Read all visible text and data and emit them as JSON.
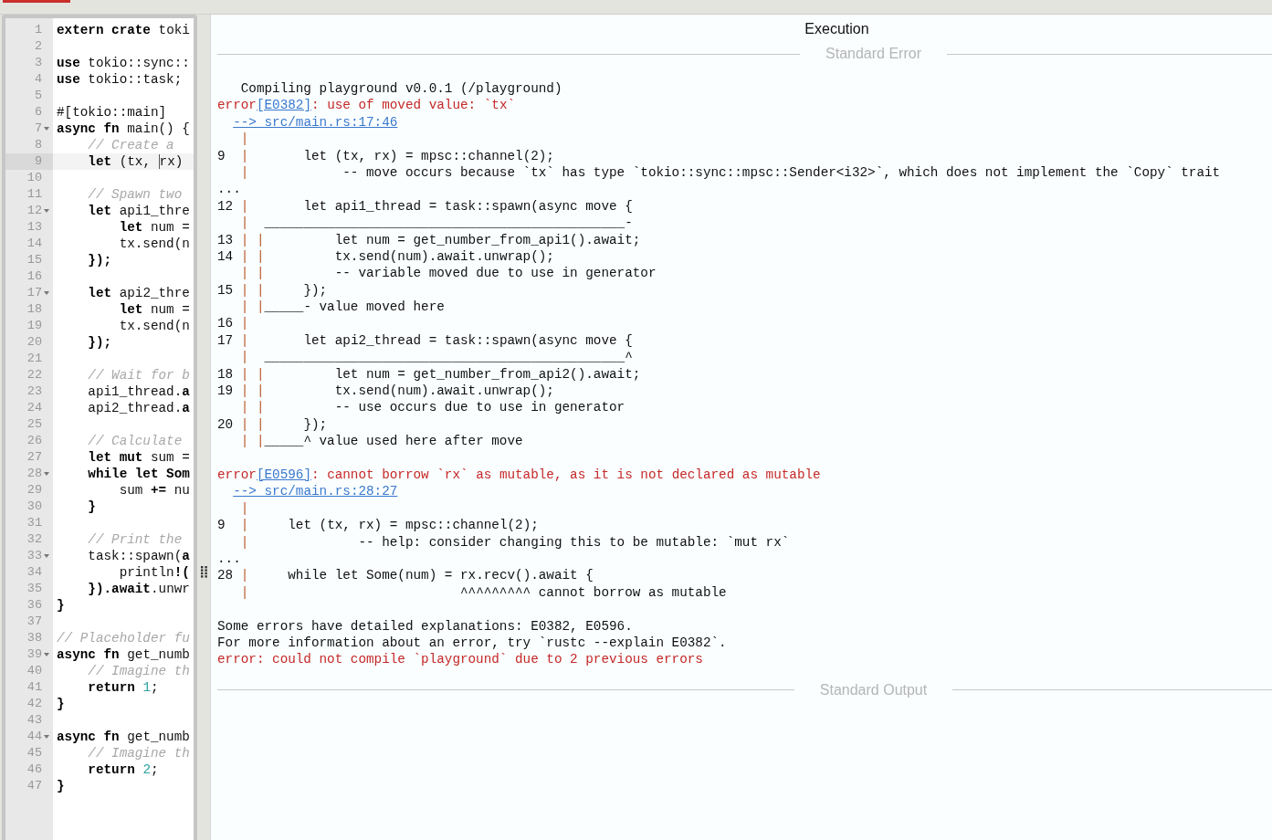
{
  "editor": {
    "lines": [
      {
        "n": "1",
        "foldable": false,
        "current": false,
        "segments": [
          {
            "kind": "bold",
            "text": "extern crate"
          },
          {
            "kind": "plain",
            "text": " toki"
          }
        ]
      },
      {
        "n": "2",
        "foldable": false,
        "current": false
      },
      {
        "n": "3",
        "foldable": false,
        "current": false,
        "segments": [
          {
            "kind": "bold",
            "text": "use"
          },
          {
            "kind": "plain",
            "text": " tokio::sync::"
          }
        ]
      },
      {
        "n": "4",
        "foldable": false,
        "current": false,
        "segments": [
          {
            "kind": "bold",
            "text": "use"
          },
          {
            "kind": "plain",
            "text": " tokio::task;"
          }
        ]
      },
      {
        "n": "5",
        "foldable": false,
        "current": false
      },
      {
        "n": "6",
        "foldable": false,
        "current": false,
        "segments": [
          {
            "kind": "plain",
            "text": "#[tokio::main]"
          }
        ]
      },
      {
        "n": "7",
        "foldable": true,
        "current": false,
        "segments": [
          {
            "kind": "bold",
            "text": "async fn"
          },
          {
            "kind": "plain",
            "text": " main() {"
          }
        ]
      },
      {
        "n": "8",
        "foldable": false,
        "current": false,
        "segments": [
          {
            "kind": "comment",
            "text": "    // Create a"
          }
        ]
      },
      {
        "n": "9",
        "foldable": false,
        "current": true,
        "segments": [
          {
            "kind": "bold",
            "text": "    let"
          },
          {
            "kind": "plain",
            "text": " (tx, "
          },
          {
            "kind": "cursor",
            "text": "rx)"
          }
        ]
      },
      {
        "n": "10",
        "foldable": false,
        "current": false
      },
      {
        "n": "11",
        "foldable": false,
        "current": false,
        "segments": [
          {
            "kind": "comment",
            "text": "    // Spawn two"
          }
        ]
      },
      {
        "n": "12",
        "foldable": true,
        "current": false,
        "segments": [
          {
            "kind": "bold",
            "text": "    let"
          },
          {
            "kind": "plain",
            "text": " api1_thre"
          }
        ]
      },
      {
        "n": "13",
        "foldable": false,
        "current": false,
        "segments": [
          {
            "kind": "bold",
            "text": "        let"
          },
          {
            "kind": "plain",
            "text": " num ="
          }
        ]
      },
      {
        "n": "14",
        "foldable": false,
        "current": false,
        "segments": [
          {
            "kind": "plain",
            "text": "        tx.send(n"
          }
        ]
      },
      {
        "n": "15",
        "foldable": false,
        "current": false,
        "segments": [
          {
            "kind": "bold",
            "text": "    });"
          }
        ]
      },
      {
        "n": "16",
        "foldable": false,
        "current": false
      },
      {
        "n": "17",
        "foldable": true,
        "current": false,
        "segments": [
          {
            "kind": "bold",
            "text": "    let"
          },
          {
            "kind": "plain",
            "text": " api2_thre"
          }
        ]
      },
      {
        "n": "18",
        "foldable": false,
        "current": false,
        "segments": [
          {
            "kind": "bold",
            "text": "        let"
          },
          {
            "kind": "plain",
            "text": " num ="
          }
        ]
      },
      {
        "n": "19",
        "foldable": false,
        "current": false,
        "segments": [
          {
            "kind": "plain",
            "text": "        tx.send(n"
          }
        ]
      },
      {
        "n": "20",
        "foldable": false,
        "current": false,
        "segments": [
          {
            "kind": "bold",
            "text": "    });"
          }
        ]
      },
      {
        "n": "21",
        "foldable": false,
        "current": false
      },
      {
        "n": "22",
        "foldable": false,
        "current": false,
        "segments": [
          {
            "kind": "comment",
            "text": "    // Wait for b"
          }
        ]
      },
      {
        "n": "23",
        "foldable": false,
        "current": false,
        "segments": [
          {
            "kind": "plain",
            "text": "    api1_thread."
          },
          {
            "kind": "bold",
            "text": "a"
          }
        ]
      },
      {
        "n": "24",
        "foldable": false,
        "current": false,
        "segments": [
          {
            "kind": "plain",
            "text": "    api2_thread."
          },
          {
            "kind": "bold",
            "text": "a"
          }
        ]
      },
      {
        "n": "25",
        "foldable": false,
        "current": false
      },
      {
        "n": "26",
        "foldable": false,
        "current": false,
        "segments": [
          {
            "kind": "comment",
            "text": "    // Calculate"
          }
        ]
      },
      {
        "n": "27",
        "foldable": false,
        "current": false,
        "segments": [
          {
            "kind": "bold",
            "text": "    let mut"
          },
          {
            "kind": "plain",
            "text": " sum ="
          }
        ]
      },
      {
        "n": "28",
        "foldable": true,
        "current": false,
        "segments": [
          {
            "kind": "bold",
            "text": "    while let Som"
          }
        ]
      },
      {
        "n": "29",
        "foldable": false,
        "current": false,
        "segments": [
          {
            "kind": "plain",
            "text": "        sum "
          },
          {
            "kind": "bold",
            "text": "+="
          },
          {
            "kind": "plain",
            "text": " nu"
          }
        ]
      },
      {
        "n": "30",
        "foldable": false,
        "current": false,
        "segments": [
          {
            "kind": "bold",
            "text": "    }"
          }
        ]
      },
      {
        "n": "31",
        "foldable": false,
        "current": false
      },
      {
        "n": "32",
        "foldable": false,
        "current": false,
        "segments": [
          {
            "kind": "comment",
            "text": "    // Print the"
          }
        ]
      },
      {
        "n": "33",
        "foldable": true,
        "current": false,
        "segments": [
          {
            "kind": "plain",
            "text": "    task::spawn("
          },
          {
            "kind": "bold",
            "text": "a"
          }
        ]
      },
      {
        "n": "34",
        "foldable": false,
        "current": false,
        "segments": [
          {
            "kind": "plain",
            "text": "        println"
          },
          {
            "kind": "bold",
            "text": "!("
          }
        ]
      },
      {
        "n": "35",
        "foldable": false,
        "current": false,
        "segments": [
          {
            "kind": "bold",
            "text": "    }).await"
          },
          {
            "kind": "plain",
            "text": ".unwr"
          }
        ]
      },
      {
        "n": "36",
        "foldable": false,
        "current": false,
        "segments": [
          {
            "kind": "bold",
            "text": "}"
          }
        ]
      },
      {
        "n": "37",
        "foldable": false,
        "current": false
      },
      {
        "n": "38",
        "foldable": false,
        "current": false,
        "segments": [
          {
            "kind": "comment",
            "text": "// Placeholder fu"
          }
        ]
      },
      {
        "n": "39",
        "foldable": true,
        "current": false,
        "segments": [
          {
            "kind": "bold",
            "text": "async fn"
          },
          {
            "kind": "plain",
            "text": " get_numb"
          }
        ]
      },
      {
        "n": "40",
        "foldable": false,
        "current": false,
        "segments": [
          {
            "kind": "comment",
            "text": "    // Imagine th"
          }
        ]
      },
      {
        "n": "41",
        "foldable": false,
        "current": false,
        "segments": [
          {
            "kind": "bold",
            "text": "    return "
          },
          {
            "kind": "number",
            "text": "1"
          },
          {
            "kind": "plain",
            "text": ";"
          }
        ]
      },
      {
        "n": "42",
        "foldable": false,
        "current": false,
        "segments": [
          {
            "kind": "bold",
            "text": "}"
          }
        ]
      },
      {
        "n": "43",
        "foldable": false,
        "current": false
      },
      {
        "n": "44",
        "foldable": true,
        "current": false,
        "segments": [
          {
            "kind": "bold",
            "text": "async fn"
          },
          {
            "kind": "plain",
            "text": " get_numb"
          }
        ]
      },
      {
        "n": "45",
        "foldable": false,
        "current": false,
        "segments": [
          {
            "kind": "comment",
            "text": "    // Imagine th"
          }
        ]
      },
      {
        "n": "46",
        "foldable": false,
        "current": false,
        "segments": [
          {
            "kind": "bold",
            "text": "    return "
          },
          {
            "kind": "number",
            "text": "2"
          },
          {
            "kind": "plain",
            "text": ";"
          }
        ]
      },
      {
        "n": "47",
        "foldable": false,
        "current": false,
        "segments": [
          {
            "kind": "bold",
            "text": "}"
          }
        ]
      }
    ]
  },
  "output": {
    "title": "Execution",
    "sections": [
      {
        "heading": "Standard Error",
        "lines": [
          {
            "kind": "text",
            "segments": [
              {
                "kind": "plain",
                "text": "   Compiling playground v0.0.1 (/playground)"
              }
            ]
          },
          {
            "kind": "text",
            "segments": [
              {
                "kind": "error",
                "text": "error"
              },
              {
                "kind": "link",
                "text": "[E0382]"
              },
              {
                "kind": "error",
                "text": ": use of moved value: `tx`"
              }
            ]
          },
          {
            "kind": "location",
            "link": "--> src/main.rs:17:46"
          },
          {
            "kind": "text",
            "segments": [
              {
                "kind": "gutter",
                "text": "   |"
              }
            ]
          },
          {
            "kind": "text",
            "segments": [
              {
                "kind": "plain",
                "text": "9  "
              },
              {
                "kind": "gutter",
                "text": "|"
              },
              {
                "kind": "plain",
                "text": "       let (tx, rx) = mpsc::channel(2);"
              }
            ]
          },
          {
            "kind": "text",
            "segments": [
              {
                "kind": "gutter",
                "text": "   |"
              },
              {
                "kind": "plain",
                "text": "            -- move occurs because `tx` has type `tokio::sync::mpsc::Sender<i32>`, which does not implement the `Copy` trait"
              }
            ]
          },
          {
            "kind": "text",
            "segments": [
              {
                "kind": "plain",
                "text": "..."
              }
            ]
          },
          {
            "kind": "text",
            "segments": [
              {
                "kind": "plain",
                "text": "12 "
              },
              {
                "kind": "gutter",
                "text": "|"
              },
              {
                "kind": "plain",
                "text": "       let api1_thread = task::spawn(async move {"
              }
            ]
          },
          {
            "kind": "text",
            "segments": [
              {
                "kind": "gutter",
                "text": "   |"
              },
              {
                "kind": "plain",
                "text": "  ______________________________________________-"
              }
            ]
          },
          {
            "kind": "text",
            "segments": [
              {
                "kind": "plain",
                "text": "13 "
              },
              {
                "kind": "gutter",
                "text": "| |"
              },
              {
                "kind": "plain",
                "text": "         let num = get_number_from_api1().await;"
              }
            ]
          },
          {
            "kind": "text",
            "segments": [
              {
                "kind": "plain",
                "text": "14 "
              },
              {
                "kind": "gutter",
                "text": "| |"
              },
              {
                "kind": "plain",
                "text": "         tx.send(num).await.unwrap();"
              }
            ]
          },
          {
            "kind": "text",
            "segments": [
              {
                "kind": "gutter",
                "text": "   | |"
              },
              {
                "kind": "plain",
                "text": "         -- variable moved due to use in generator"
              }
            ]
          },
          {
            "kind": "text",
            "segments": [
              {
                "kind": "plain",
                "text": "15 "
              },
              {
                "kind": "gutter",
                "text": "| |"
              },
              {
                "kind": "plain",
                "text": "     });"
              }
            ]
          },
          {
            "kind": "text",
            "segments": [
              {
                "kind": "gutter",
                "text": "   | |"
              },
              {
                "kind": "plain",
                "text": "_____- value moved here"
              }
            ]
          },
          {
            "kind": "text",
            "segments": [
              {
                "kind": "plain",
                "text": "16 "
              },
              {
                "kind": "gutter",
                "text": "|"
              }
            ]
          },
          {
            "kind": "text",
            "segments": [
              {
                "kind": "plain",
                "text": "17 "
              },
              {
                "kind": "gutter",
                "text": "|"
              },
              {
                "kind": "plain",
                "text": "       let api2_thread = task::spawn(async move {"
              }
            ]
          },
          {
            "kind": "text",
            "segments": [
              {
                "kind": "gutter",
                "text": "   |"
              },
              {
                "kind": "plain",
                "text": "  ______________________________________________^"
              }
            ]
          },
          {
            "kind": "text",
            "segments": [
              {
                "kind": "plain",
                "text": "18 "
              },
              {
                "kind": "gutter",
                "text": "| |"
              },
              {
                "kind": "plain",
                "text": "         let num = get_number_from_api2().await;"
              }
            ]
          },
          {
            "kind": "text",
            "segments": [
              {
                "kind": "plain",
                "text": "19 "
              },
              {
                "kind": "gutter",
                "text": "| |"
              },
              {
                "kind": "plain",
                "text": "         tx.send(num).await.unwrap();"
              }
            ]
          },
          {
            "kind": "text",
            "segments": [
              {
                "kind": "gutter",
                "text": "   | |"
              },
              {
                "kind": "plain",
                "text": "         -- use occurs due to use in generator"
              }
            ]
          },
          {
            "kind": "text",
            "segments": [
              {
                "kind": "plain",
                "text": "20 "
              },
              {
                "kind": "gutter",
                "text": "| |"
              },
              {
                "kind": "plain",
                "text": "     });"
              }
            ]
          },
          {
            "kind": "text",
            "segments": [
              {
                "kind": "gutter",
                "text": "   | |"
              },
              {
                "kind": "plain",
                "text": "_____^ value used here after move"
              }
            ]
          },
          {
            "kind": "blank"
          },
          {
            "kind": "text",
            "segments": [
              {
                "kind": "error",
                "text": "error"
              },
              {
                "kind": "link",
                "text": "[E0596]"
              },
              {
                "kind": "error",
                "text": ": cannot borrow `rx` as mutable, as it is not declared as mutable"
              }
            ]
          },
          {
            "kind": "location",
            "link": "--> src/main.rs:28:27"
          },
          {
            "kind": "text",
            "segments": [
              {
                "kind": "gutter",
                "text": "   |"
              }
            ]
          },
          {
            "kind": "text",
            "segments": [
              {
                "kind": "plain",
                "text": "9  "
              },
              {
                "kind": "gutter",
                "text": "|"
              },
              {
                "kind": "plain",
                "text": "     let (tx, rx) = mpsc::channel(2);"
              }
            ]
          },
          {
            "kind": "text",
            "segments": [
              {
                "kind": "gutter",
                "text": "   |"
              },
              {
                "kind": "plain",
                "text": "              -- help: consider changing this to be mutable: `mut rx`"
              }
            ]
          },
          {
            "kind": "text",
            "segments": [
              {
                "kind": "plain",
                "text": "..."
              }
            ]
          },
          {
            "kind": "text",
            "segments": [
              {
                "kind": "plain",
                "text": "28 "
              },
              {
                "kind": "gutter",
                "text": "|"
              },
              {
                "kind": "plain",
                "text": "     while let Some(num) = rx.recv().await {"
              }
            ]
          },
          {
            "kind": "text",
            "segments": [
              {
                "kind": "gutter",
                "text": "   |"
              },
              {
                "kind": "plain",
                "text": "                           ^^^^^^^^^ cannot borrow as mutable"
              }
            ]
          },
          {
            "kind": "blank"
          },
          {
            "kind": "text",
            "segments": [
              {
                "kind": "plain",
                "text": "Some errors have detailed explanations: E0382, E0596."
              }
            ]
          },
          {
            "kind": "text",
            "segments": [
              {
                "kind": "plain",
                "text": "For more information about an error, try `rustc --explain E0382`."
              }
            ]
          },
          {
            "kind": "text",
            "segments": [
              {
                "kind": "error",
                "text": "error: could not compile `playground` due to 2 previous errors"
              }
            ]
          }
        ]
      },
      {
        "heading": "Standard Output"
      }
    ]
  }
}
